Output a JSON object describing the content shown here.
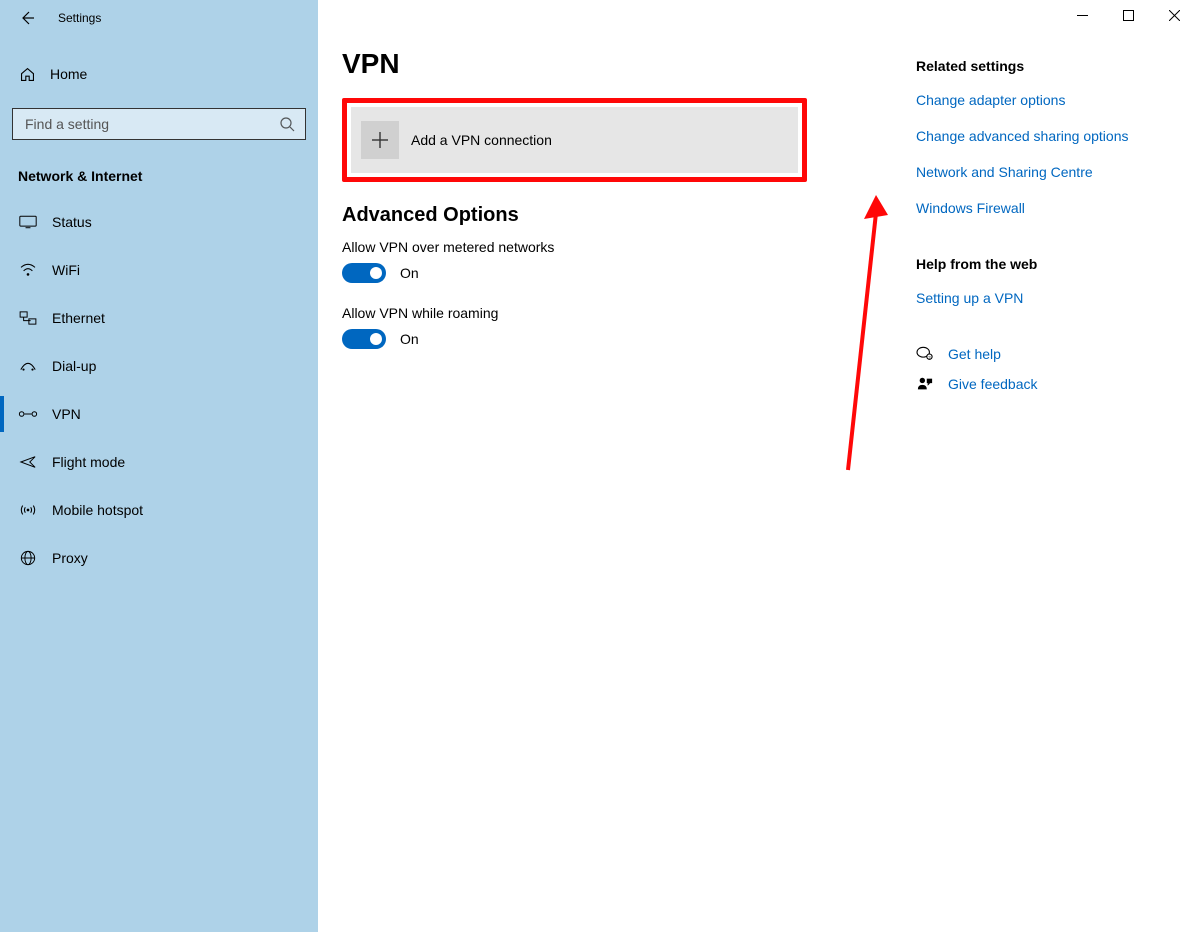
{
  "titlebar": {
    "app_name": "Settings"
  },
  "sidebar": {
    "home_label": "Home",
    "search_placeholder": "Find a setting",
    "category_label": "Network & Internet",
    "items": [
      {
        "label": "Status"
      },
      {
        "label": "WiFi"
      },
      {
        "label": "Ethernet"
      },
      {
        "label": "Dial-up"
      },
      {
        "label": "VPN"
      },
      {
        "label": "Flight mode"
      },
      {
        "label": "Mobile hotspot"
      },
      {
        "label": "Proxy"
      }
    ]
  },
  "main": {
    "page_title": "VPN",
    "add_vpn_label": "Add a VPN connection",
    "advanced_title": "Advanced Options",
    "option1_label": "Allow VPN over metered networks",
    "option1_state": "On",
    "option2_label": "Allow VPN while roaming",
    "option2_state": "On"
  },
  "related": {
    "heading": "Related settings",
    "links": [
      "Change adapter options",
      "Change advanced sharing options",
      "Network and Sharing Centre",
      "Windows Firewall"
    ]
  },
  "help": {
    "heading": "Help from the web",
    "links": [
      "Setting up a VPN"
    ],
    "get_help": "Get help",
    "give_feedback": "Give feedback"
  }
}
